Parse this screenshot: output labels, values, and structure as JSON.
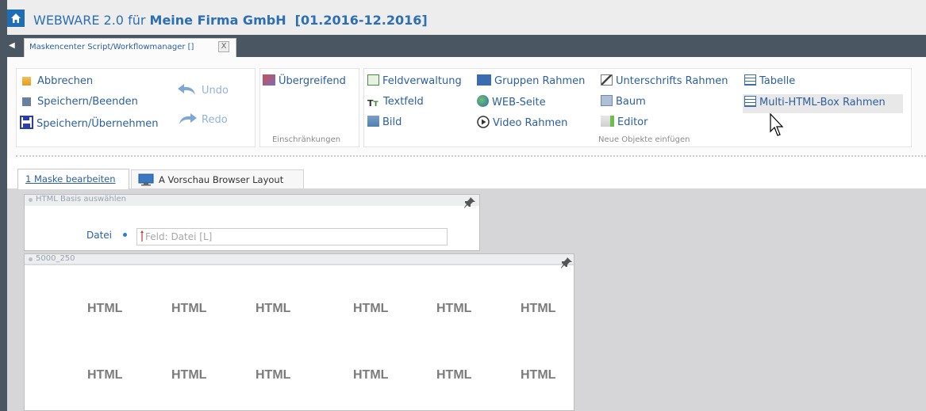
{
  "window": {
    "title_prefix": "WEBWARE 2.0 für",
    "company": "Meine Firma GmbH",
    "period": "[01.2016-12.2016]"
  },
  "tab": {
    "label": "Maskencenter Script/Workflowmanager []",
    "close": "X"
  },
  "ribbon": {
    "group1": {
      "abbrechen": "Abbrechen",
      "speichern_beenden": "Speichern/Beenden",
      "speichern_uebernehmen": "Speichern/Übernehmen",
      "undo": "Undo",
      "redo": "Redo"
    },
    "group2": {
      "uebergreifend": "Übergreifend",
      "caption": "Einschränkungen"
    },
    "group3": {
      "feldverwaltung": "Feldverwaltung",
      "textfeld": "Textfeld",
      "bild": "Bild",
      "gruppen_rahmen": "Gruppen Rahmen",
      "web_seite": "WEB-Seite",
      "video_rahmen": "Video Rahmen",
      "unterschrifts_rahmen": "Unterschrifts Rahmen",
      "baum": "Baum",
      "editor": "Editor",
      "tabelle": "Tabelle",
      "multi_html": "Multi-HTML-Box Rahmen",
      "caption": "Neue Objekte einfügen"
    }
  },
  "view_tabs": {
    "tab1": "1 Maske bearbeiten",
    "tab2": "A Vorschau Browser Layout"
  },
  "panel_a": {
    "title": "HTML Basis auswählen",
    "field_label": "Datei",
    "field_value": "Feld: Datei  [L]"
  },
  "panel_b": {
    "title": "5000_250",
    "boxes": [
      "HTML",
      "HTML",
      "HTML",
      "HTML",
      "HTML",
      "HTML",
      "HTML",
      "HTML",
      "HTML",
      "HTML",
      "HTML",
      "HTML"
    ]
  },
  "colors": {
    "accent": "#2c5f9e",
    "dark_bar": "#4b5663",
    "home_button": "#1f6db5"
  }
}
